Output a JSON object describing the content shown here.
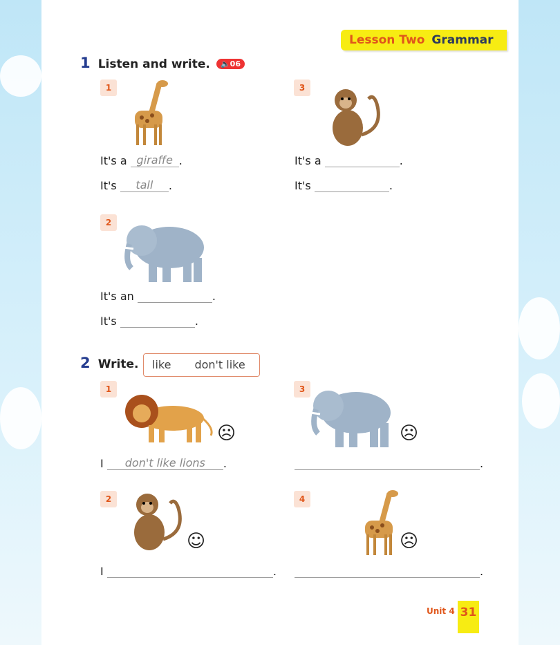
{
  "header": {
    "lesson": "Lesson Two",
    "topic": "Grammar"
  },
  "section1": {
    "number": "1",
    "title": "Listen and write.",
    "audio": "06",
    "items": [
      {
        "num": "1",
        "animal": "giraffe",
        "line1_prefix": "It's a",
        "line1_answer": "giraffe",
        "line2_prefix": "It's",
        "line2_answer": "tall"
      },
      {
        "num": "2",
        "animal": "elephant",
        "line1_prefix": "It's an",
        "line1_answer": "",
        "line2_prefix": "It's",
        "line2_answer": ""
      },
      {
        "num": "3",
        "animal": "monkey",
        "line1_prefix": "It's a",
        "line1_answer": "",
        "line2_prefix": "It's",
        "line2_answer": ""
      }
    ]
  },
  "section2": {
    "number": "2",
    "title": "Write.",
    "words": [
      "like",
      "don't like"
    ],
    "items": [
      {
        "num": "1",
        "animal": "lion",
        "face": "☹",
        "prefix": "I",
        "answer": "don't like lions"
      },
      {
        "num": "2",
        "animal": "monkey",
        "face": "☺",
        "prefix": "I",
        "answer": ""
      },
      {
        "num": "3",
        "animal": "elephant",
        "face": "☹",
        "prefix": "",
        "answer": ""
      },
      {
        "num": "4",
        "animal": "giraffe",
        "face": "☹",
        "prefix": "",
        "answer": ""
      }
    ]
  },
  "footer": {
    "unit": "Unit 4",
    "page": "31"
  },
  "period": "."
}
